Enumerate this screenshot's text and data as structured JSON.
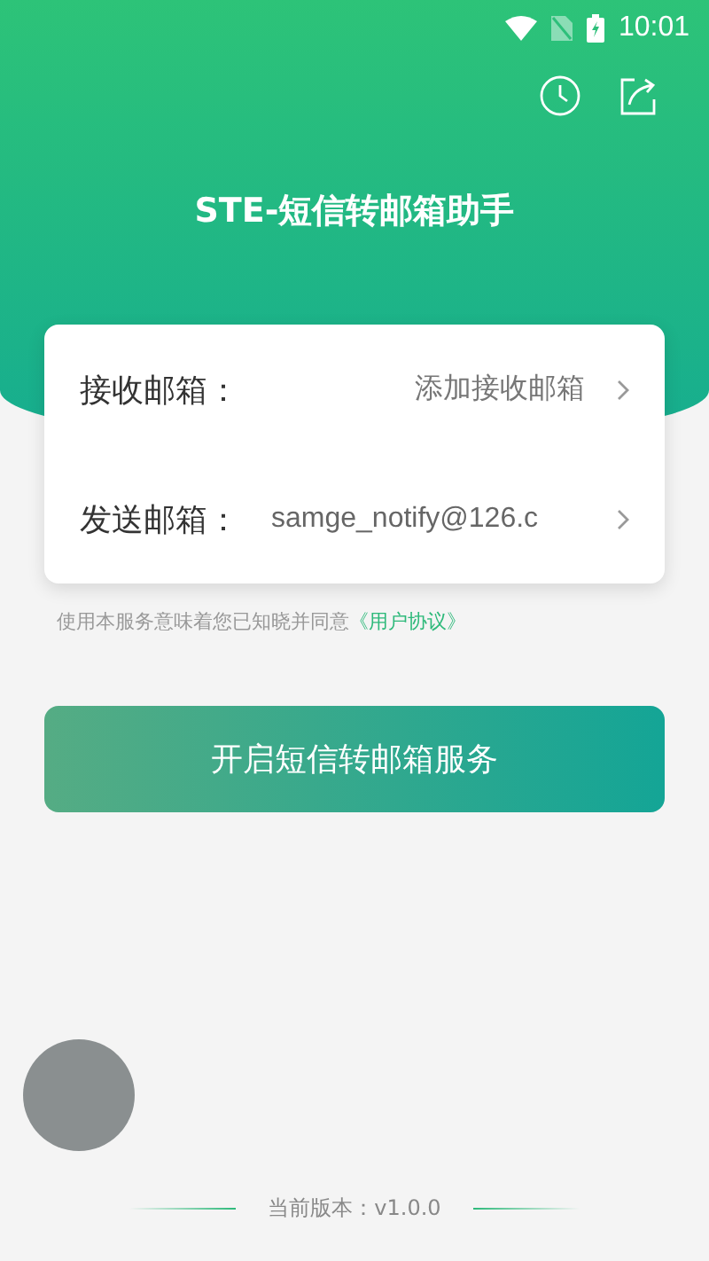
{
  "status_bar": {
    "time": "10:01"
  },
  "title": "STE-短信转邮箱助手",
  "email_rows": [
    {
      "label": "接收邮箱：",
      "value": "添加接收邮箱",
      "placeholder": true
    },
    {
      "label": "发送邮箱：",
      "value": "samge_notify@126.c",
      "placeholder": false
    }
  ],
  "agreement": {
    "text": "使用本服务意味着您已知晓并同意",
    "link": "《用户协议》"
  },
  "start_button": "开启短信转邮箱服务",
  "version": "当前版本：v1.0.0"
}
